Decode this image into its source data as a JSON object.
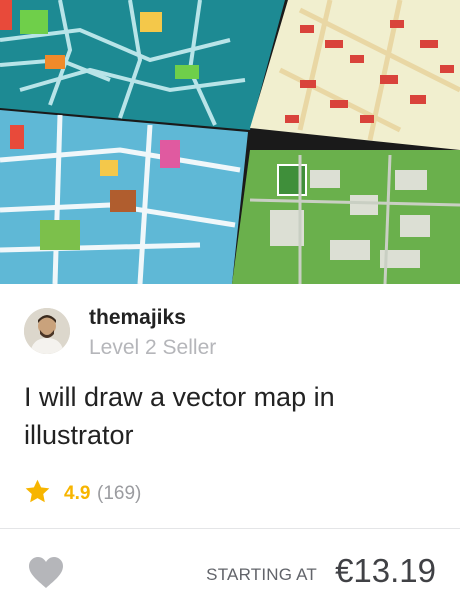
{
  "gig": {
    "title": "I will draw a vector map in illustrator"
  },
  "seller": {
    "name": "themajiks",
    "level": "Level 2 Seller"
  },
  "rating": {
    "score": "4.9",
    "count": "(169)"
  },
  "pricing": {
    "label": "STARTING AT",
    "amount": "€13.19"
  },
  "icons": {
    "rating": "star-icon",
    "favorite": "heart-icon"
  },
  "colors": {
    "star": "#f7b500",
    "heart": "#b5b6ba",
    "seller_name": "#222222",
    "muted": "#9b9ca0"
  }
}
